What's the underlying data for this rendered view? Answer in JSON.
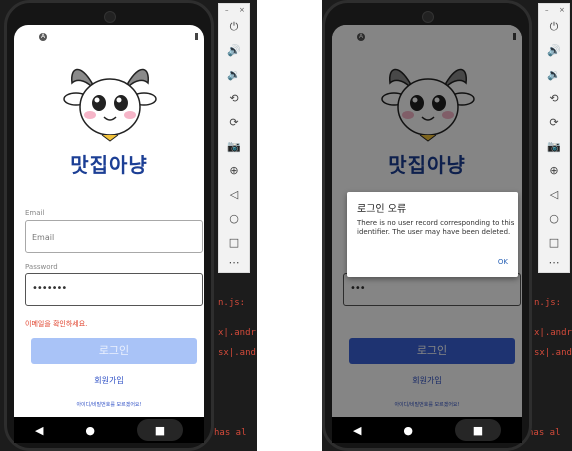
{
  "left_screen": {
    "brand": "맛집아냥",
    "email_label": "Email",
    "email_placeholder": "Email",
    "password_label": "Password",
    "password_value": "•••••••",
    "error_text": "이메일을 확인하세요.",
    "login_button": "로그인",
    "signup_link": "회원가입",
    "forgot_link": "아이디/비밀번호를 모르겠어요!"
  },
  "right_screen": {
    "brand": "맛집아냥",
    "password_value": "•••",
    "login_button": "로그인",
    "signup_link": "회원가입",
    "forgot_link": "아이디/비밀번호를 모르겠어요!",
    "dialog": {
      "title": "로그인 오류",
      "message": "There is no user record corresponding to this identifier. The user may have been deleted.",
      "ok": "OK"
    }
  },
  "emulator_controls": {
    "minimize": "–",
    "close": "×",
    "icons": [
      "power-icon",
      "volume-up-icon",
      "volume-down-icon",
      "rotate-left-icon",
      "rotate-right-icon",
      "camera-icon",
      "zoom-icon",
      "back-icon",
      "home-icon",
      "overview-icon",
      "more-icon"
    ]
  },
  "terminal": {
    "left": [
      "n.js:",
      "x|.andr",
      "sx|.andr",
      "has al"
    ],
    "right": [
      "n.js:",
      "x|.andro",
      "sx|.andr",
      "has al"
    ]
  },
  "colors": {
    "brand": "#1c3f95",
    "button_disabled": "#a9c3f7",
    "button_active": "#3a63d8",
    "error": "#e0402a",
    "link": "#2a4cc4"
  }
}
